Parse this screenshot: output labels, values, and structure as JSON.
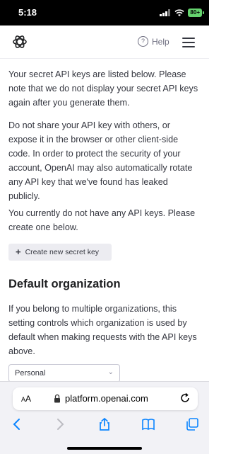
{
  "status": {
    "time": "5:18",
    "battery": "80+"
  },
  "header": {
    "help_label": "Help",
    "logo_icon": "openai-logo-icon",
    "menu_icon": "hamburger-menu-icon"
  },
  "content": {
    "intro": "Your secret API keys are listed below. Please note that we do not display your secret API keys again after you generate them.",
    "warning": "Do not share your API key with others, or expose it in the browser or other client-side code. In order to protect the security of your account, OpenAI may also automatically rotate any API key that we've found has leaked publicly.",
    "no_keys": "You currently do not have any API keys. Please create one below.",
    "create_button": "Create new secret key",
    "default_org_title": "Default organization",
    "default_org_desc": "If you belong to multiple organizations, this setting controls which organization is used by default when making requests with the API keys above.",
    "org_select_value": "Personal"
  },
  "browser": {
    "url": "platform.openai.com",
    "text_size_label": "AA"
  },
  "colors": {
    "accent": "#0a84ff",
    "button_bg": "#ececf1",
    "text": "#353740"
  }
}
